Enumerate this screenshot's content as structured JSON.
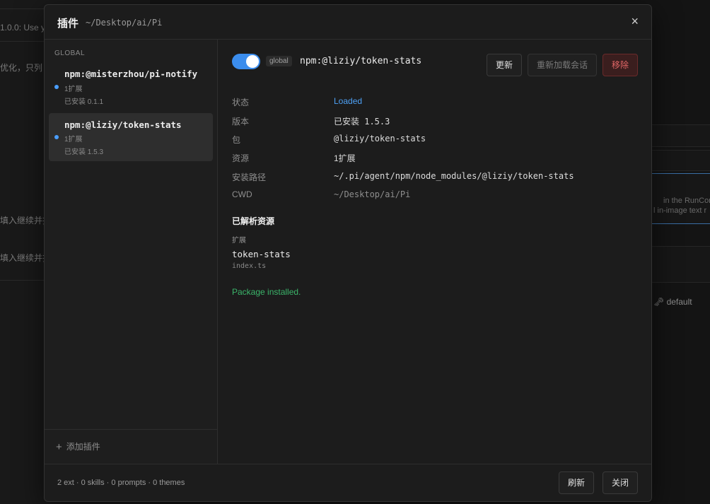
{
  "background": {
    "left_rows": [
      "1.0.0: Use y",
      "优化，只列",
      "填入继续并抵",
      "填入继续并抵"
    ],
    "right_notes": [
      "in the RunCom",
      "l in-image text r"
    ],
    "default_label": "default",
    "key_icon": "key-icon"
  },
  "modal": {
    "title": "插件",
    "path": "~/Desktop/ai/Pi",
    "close_icon": "×"
  },
  "sidebar": {
    "group_label": "GLOBAL",
    "items": [
      {
        "name": "npm:@misterzhou/pi-notify",
        "type": "1扩展",
        "installed": "已安装 0.1.1",
        "active": false
      },
      {
        "name": "npm:@liziy/token-stats",
        "type": "1扩展",
        "installed": "已安装 1.5.3",
        "active": true
      }
    ],
    "add_label": "添加插件",
    "add_icon": "+"
  },
  "detail": {
    "enabled": true,
    "scope_badge": "global",
    "package_title": "npm:@liziy/token-stats",
    "buttons": {
      "update": "更新",
      "reload": "重新加载会话",
      "remove": "移除"
    },
    "info": [
      {
        "label": "状态",
        "value": "Loaded",
        "style": "blue"
      },
      {
        "label": "版本",
        "value": "已安装 1.5.3",
        "style": ""
      },
      {
        "label": "包",
        "value": "@liziy/token-stats",
        "style": ""
      },
      {
        "label": "资源",
        "value": "1扩展",
        "style": ""
      },
      {
        "label": "安装路径",
        "value": "~/.pi/agent/npm/node_modules/@liziy/token-stats",
        "style": ""
      },
      {
        "label": "CWD",
        "value": "~/Desktop/ai/Pi",
        "style": "muted"
      }
    ],
    "resolved_title": "已解析资源",
    "resource_category": "扩展",
    "resource_name": "token-stats",
    "resource_file": "index.ts",
    "status_message": "Package installed."
  },
  "footer": {
    "summary": "2 ext · 0 skills · 0 prompts · 0 themes",
    "refresh_label": "刷新",
    "close_label": "关闭"
  },
  "colors": {
    "accent": "#3b8ded",
    "status_loaded": "#4ea1f5",
    "success": "#3bb56a",
    "danger": "#e06666"
  }
}
